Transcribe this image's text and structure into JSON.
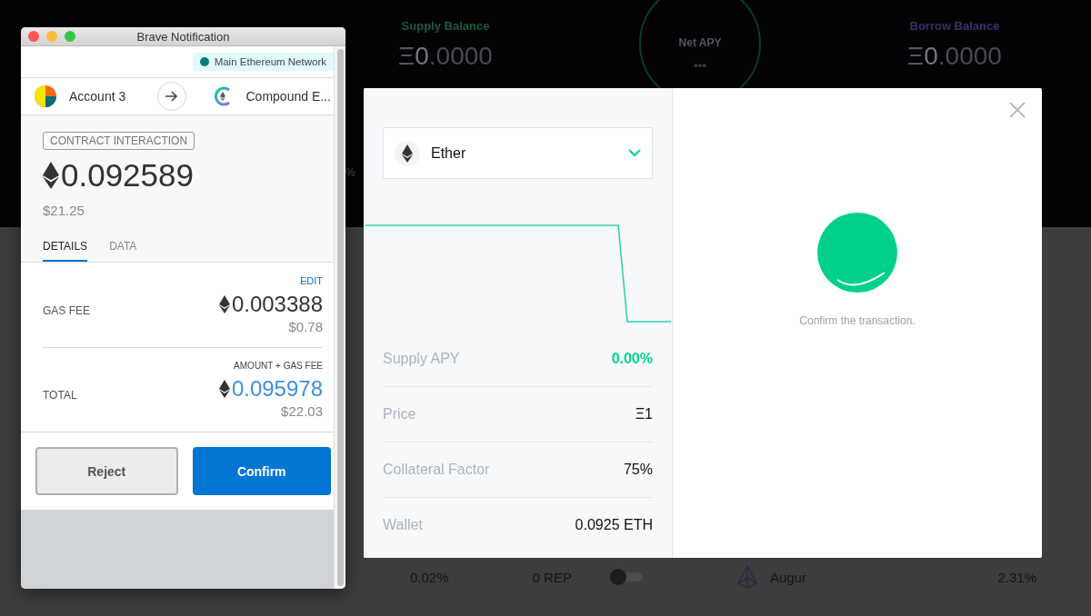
{
  "background": {
    "balances": [
      {
        "label": "Supply Balance",
        "symbol": "Ξ",
        "whole": "0",
        "fraction": ".0000",
        "color": "#1d5a3c"
      },
      {
        "label": "Borrow Balance",
        "symbol": "Ξ",
        "whole": "0",
        "fraction": ".0000",
        "color": "#3a2f6b"
      }
    ],
    "net_apy": {
      "label": "Net APY",
      "value": "•••"
    },
    "fragment": "%",
    "market_row": {
      "apy": "0.02%",
      "balance": "0 REP",
      "toggle_on": false,
      "name": "Augur",
      "rate": "2.31%"
    }
  },
  "popup": {
    "title": "Brave Notification",
    "network": "Main Ethereum Network",
    "from": "Account 3",
    "to": "Compound E...",
    "badge": "CONTRACT INTERACTION",
    "amount": "0.092589",
    "fiat": "$21.25",
    "tabs": [
      {
        "label": "DETAILS",
        "selected": true
      },
      {
        "label": "DATA",
        "selected": false
      }
    ],
    "gas": {
      "label": "GAS FEE",
      "edit": "EDIT",
      "amount": "0.003388",
      "fiat": "$0.78"
    },
    "total": {
      "label": "TOTAL",
      "note": "AMOUNT + GAS FEE",
      "amount": "0.095978",
      "fiat": "$22.03"
    },
    "buttons": [
      {
        "label": "Reject",
        "kind": "secondary"
      },
      {
        "label": "Confirm",
        "kind": "primary"
      }
    ]
  },
  "modal": {
    "asset": "Ether",
    "rows": [
      {
        "label": "Supply APY",
        "value": "0.00%",
        "positive": true
      },
      {
        "label": "Price",
        "value": "Ξ1",
        "positive": false
      },
      {
        "label": "Collateral Factor",
        "value": "75%",
        "positive": false
      },
      {
        "label": "Wallet",
        "value": "0.0925 ETH",
        "positive": false
      }
    ],
    "status": "Confirm the transaction."
  }
}
